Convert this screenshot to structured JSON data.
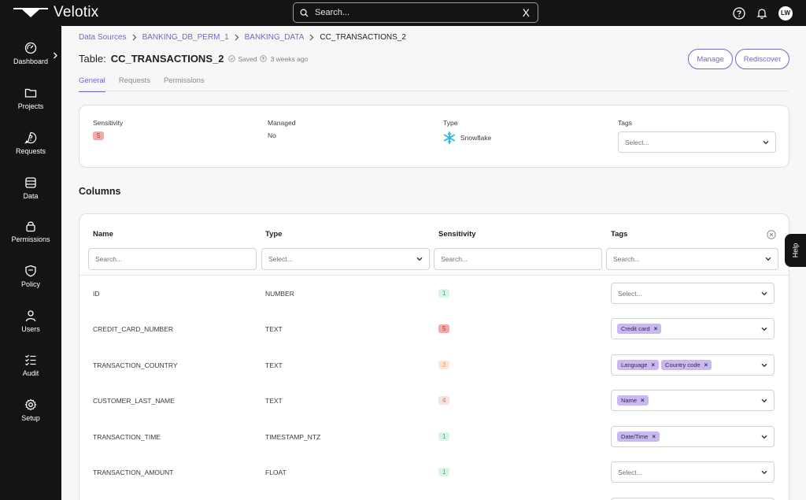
{
  "app": {
    "name": "Velotix"
  },
  "search": {
    "placeholder": "Search...",
    "clear_label": "X"
  },
  "user": {
    "initials": "LW"
  },
  "sidebar": {
    "items": [
      {
        "label": "Dashboard",
        "icon": "dashboard-gauge-icon"
      },
      {
        "label": "Projects",
        "icon": "folder-icon"
      },
      {
        "label": "Requests",
        "icon": "question-bubble-icon"
      },
      {
        "label": "Data",
        "icon": "database-icon"
      },
      {
        "label": "Permissions",
        "icon": "lock-icon"
      },
      {
        "label": "Policy",
        "icon": "shield-icon"
      },
      {
        "label": "Users",
        "icon": "user-icon"
      },
      {
        "label": "Audit",
        "icon": "checklist-icon"
      },
      {
        "label": "Setup",
        "icon": "gear-icon"
      }
    ]
  },
  "breadcrumb": {
    "items": [
      "Data Sources",
      "BANKING_DB_PERM_1",
      "BANKING_DATA",
      "CC_TRANSACTIONS_2"
    ]
  },
  "header": {
    "prefix": "Table:",
    "table_name": "CC_TRANSACTIONS_2",
    "saved_status": "Saved",
    "saved_time": "3 weeks ago",
    "manage_label": "Manage",
    "rediscover_label": "Rediscover"
  },
  "tabs": [
    {
      "label": "General",
      "active": true
    },
    {
      "label": "Requests",
      "active": false
    },
    {
      "label": "Permissions",
      "active": false
    }
  ],
  "info": {
    "sensitivity_label": "Sensitivity",
    "sensitivity_value": "5",
    "managed_label": "Managed",
    "managed_value": "No",
    "type_label": "Type",
    "type_value": "Snowflake",
    "tags_label": "Tags",
    "tags_placeholder": "Select..."
  },
  "columns_section": {
    "title": "Columns",
    "headers": {
      "name": "Name",
      "type": "Type",
      "sensitivity": "Sensitivity",
      "tags": "Tags"
    },
    "filters": {
      "name_placeholder": "Search...",
      "type_placeholder": "Select...",
      "sensitivity_placeholder": "Search...",
      "tags_placeholder": "Search..."
    },
    "tag_select_placeholder": "Select...",
    "rows": [
      {
        "name": "ID",
        "type": "NUMBER",
        "sensitivity": "1",
        "tags": []
      },
      {
        "name": "CREDIT_CARD_NUMBER",
        "type": "TEXT",
        "sensitivity": "5",
        "tags": [
          "Credit card"
        ]
      },
      {
        "name": "TRANSACTION_COUNTRY",
        "type": "TEXT",
        "sensitivity": "3",
        "tags": [
          "Language",
          "Country code"
        ]
      },
      {
        "name": "CUSTOMER_LAST_NAME",
        "type": "TEXT",
        "sensitivity": "4",
        "tags": [
          "Name"
        ]
      },
      {
        "name": "TRANSACTION_TIME",
        "type": "TIMESTAMP_NTZ",
        "sensitivity": "1",
        "tags": [
          "Date/Time"
        ]
      },
      {
        "name": "TRANSACTION_AMOUNT",
        "type": "FLOAT",
        "sensitivity": "1",
        "tags": []
      }
    ]
  },
  "help": {
    "label": "Help"
  },
  "colors": {
    "accent": "#7a64c8",
    "chip": "#c9b8f2",
    "topbar": "#141414",
    "snowflake": "#29b5e8"
  }
}
